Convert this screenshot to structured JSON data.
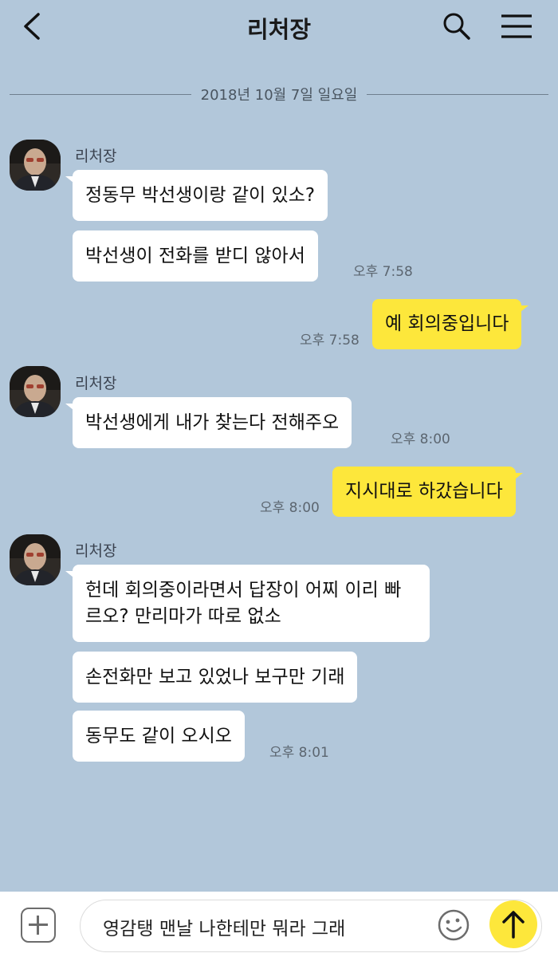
{
  "header": {
    "title": "리처장"
  },
  "date_divider": "2018년 10월 7일 일요일",
  "messages": [
    {
      "sender": "리처장",
      "bubbles": [
        "정동무 박선생이랑 같이 있소?",
        "박선생이 전화를 받디 않아서"
      ],
      "time": "오후 7:58"
    },
    {
      "mine": true,
      "bubbles": [
        "예 회의중입니다"
      ],
      "time": "오후 7:58"
    },
    {
      "sender": "리처장",
      "bubbles": [
        "박선생에게 내가 찾는다 전해주오"
      ],
      "time": "오후 8:00"
    },
    {
      "mine": true,
      "bubbles": [
        "지시대로 하갔습니다"
      ],
      "time": "오후 8:00"
    },
    {
      "sender": "리처장",
      "bubbles": [
        "헌데 회의중이라면서 답장이 어찌 이리 빠르오? 만리마가 따로 없소",
        "손전화만 보고 있었나 보구만 기래",
        "동무도 같이 오시오"
      ],
      "time": "오후 8:01"
    }
  ],
  "input": {
    "value": "영감탱 맨날 나한테만 뭐라 그래"
  },
  "icons": {
    "back": "chevron-left-icon",
    "search": "search-icon",
    "menu": "hamburger-menu-icon",
    "plus": "plus-icon",
    "emoji": "emoji-icon",
    "send": "arrow-up-icon"
  },
  "colors": {
    "background": "#b2c7da",
    "my_bubble": "#fde73b",
    "their_bubble": "#ffffff"
  }
}
